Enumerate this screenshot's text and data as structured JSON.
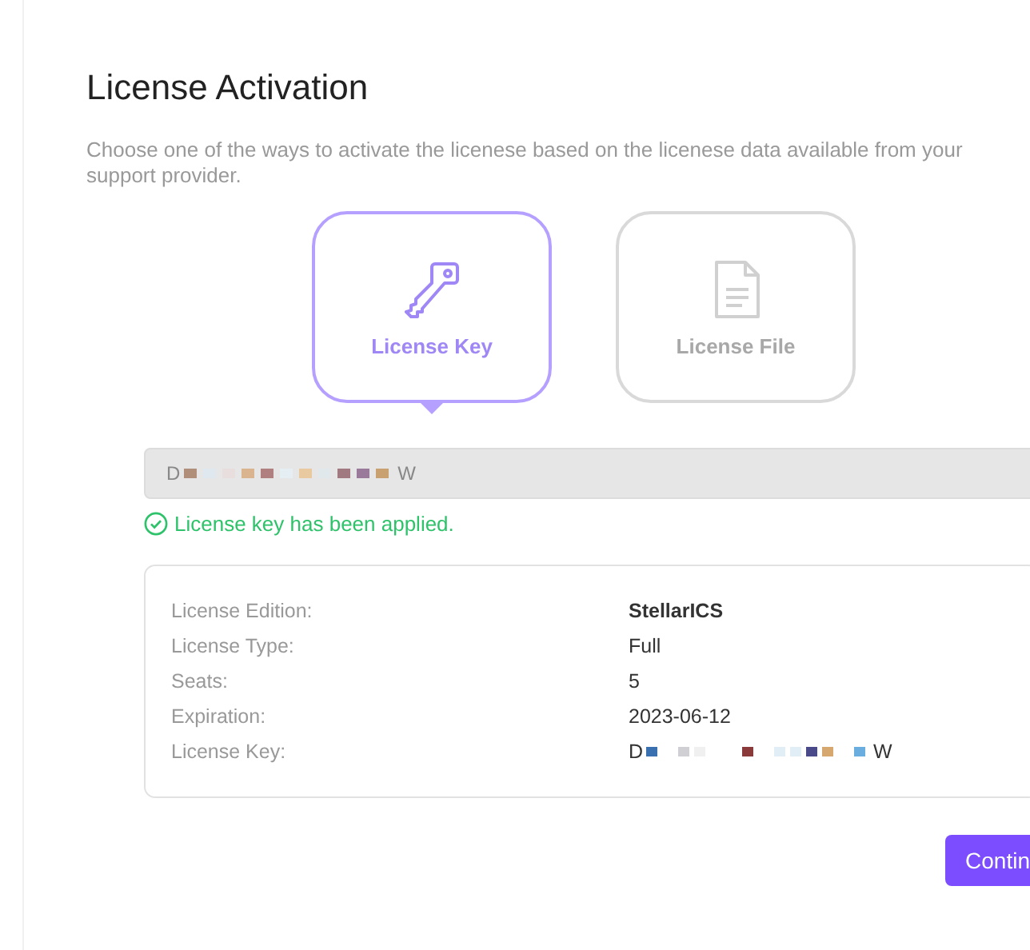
{
  "title": "License Activation",
  "description": "Choose one of the ways to activate the licenese based on the licenese data available from your support provider.",
  "methods": [
    {
      "kind": "key",
      "label": "License Key",
      "selected": true
    },
    {
      "kind": "file",
      "label": "License File",
      "selected": false
    }
  ],
  "key_field": {
    "value_start": "D",
    "value_end": "W"
  },
  "status": {
    "text": "License key has been applied.",
    "success": true
  },
  "details": [
    {
      "label": "License Edition:",
      "value": "StellarICS",
      "bold": true
    },
    {
      "label": "License Type:",
      "value": "Full",
      "bold": false
    },
    {
      "label": "Seats:",
      "value": "5",
      "bold": false
    },
    {
      "label": "Expiration:",
      "value": "2023-06-12",
      "bold": false
    },
    {
      "label": "License Key:",
      "value_start": "D",
      "value_end": "W",
      "bold": false
    }
  ],
  "continue_button": "Contin"
}
